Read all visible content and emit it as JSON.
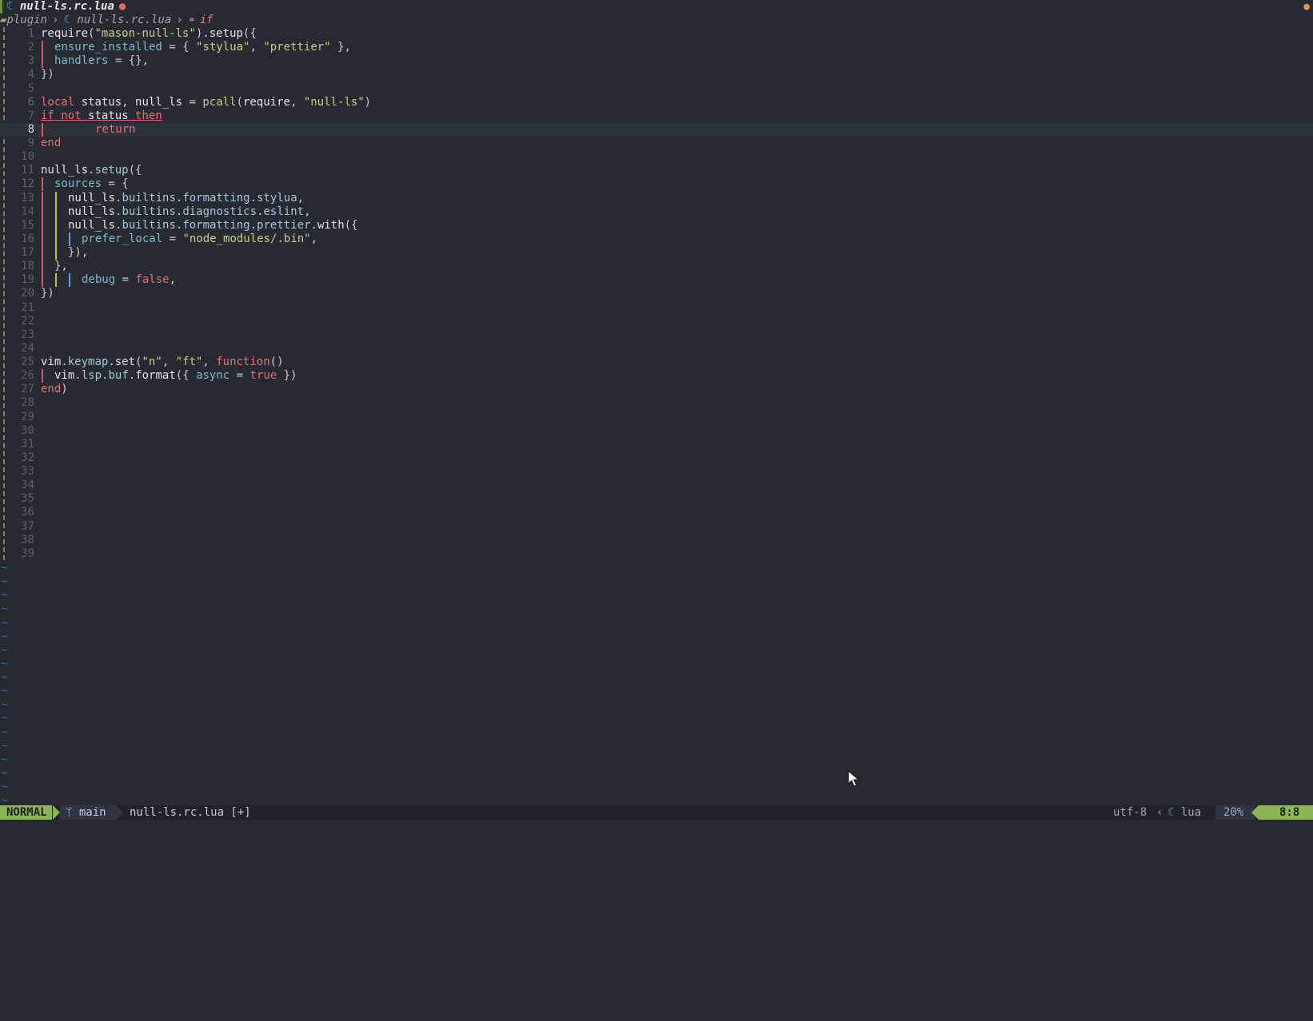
{
  "tabline": {
    "file_icon": "lua-moon-icon",
    "filename": "null-ls.rc.lua",
    "modified_indicator": "●",
    "right_indicator": "●"
  },
  "winbar": {
    "folder": "plugin",
    "separator": "›",
    "file": "null-ls.rc.lua",
    "scope_icon": "⚭",
    "scope": "if"
  },
  "editor": {
    "lines": [
      {
        "n": "1",
        "tokens": [
          [
            "fn",
            "require"
          ],
          [
            "punc",
            "("
          ],
          [
            "str",
            "\"mason-null-ls\""
          ],
          [
            "punc",
            ")."
          ],
          [
            "fn",
            "setup"
          ],
          [
            "punc",
            "({"
          ]
        ]
      },
      {
        "n": "2",
        "guides": [
          "red"
        ],
        "tokens": [
          [
            "var",
            "ensure_installed"
          ],
          [
            "punc",
            " = { "
          ],
          [
            "str",
            "\"stylua\""
          ],
          [
            "punc",
            ", "
          ],
          [
            "str",
            "\"prettier\""
          ],
          [
            "punc",
            " },"
          ]
        ]
      },
      {
        "n": "3",
        "guides": [
          "red"
        ],
        "tokens": [
          [
            "var",
            "handlers"
          ],
          [
            "punc",
            " = {},"
          ]
        ]
      },
      {
        "n": "4",
        "tokens": [
          [
            "punc",
            "})"
          ]
        ]
      },
      {
        "n": "5",
        "tokens": []
      },
      {
        "n": "6",
        "tokens": [
          [
            "kw",
            "local"
          ],
          [
            "punc",
            " "
          ],
          [
            "fn",
            "status"
          ],
          [
            "punc",
            ", "
          ],
          [
            "fn",
            "null_ls"
          ],
          [
            "punc",
            " = "
          ],
          [
            "str",
            "pcall"
          ],
          [
            "punc",
            "("
          ],
          [
            "fn",
            "require"
          ],
          [
            "punc",
            ", "
          ],
          [
            "str",
            "\"null-ls\""
          ],
          [
            "punc",
            ")"
          ]
        ]
      },
      {
        "n": "7",
        "underline": true,
        "tokens": [
          [
            "kw",
            "if"
          ],
          [
            "punc",
            " "
          ],
          [
            "kw",
            "not"
          ],
          [
            "punc",
            " "
          ],
          [
            "fn",
            "status"
          ],
          [
            "punc",
            " "
          ],
          [
            "kw",
            "then"
          ]
        ]
      },
      {
        "n": "8",
        "current": true,
        "guides": [
          "red",
          "pad",
          "pad",
          "pad"
        ],
        "tokens": [
          [
            "kw",
            "return"
          ]
        ]
      },
      {
        "n": "9",
        "tokens": [
          [
            "kw",
            "end"
          ]
        ]
      },
      {
        "n": "10",
        "tokens": []
      },
      {
        "n": "11",
        "tokens": [
          [
            "fn",
            "null_ls"
          ],
          [
            "punc",
            "."
          ],
          [
            "field",
            "setup"
          ],
          [
            "punc",
            "({"
          ]
        ]
      },
      {
        "n": "12",
        "guides": [
          "red"
        ],
        "tokens": [
          [
            "var",
            "sources"
          ],
          [
            "punc",
            " = {"
          ]
        ]
      },
      {
        "n": "13",
        "guides": [
          "red",
          "yel"
        ],
        "tokens": [
          [
            "fn",
            "null_ls"
          ],
          [
            "punc",
            "."
          ],
          [
            "field",
            "builtins"
          ],
          [
            "punc",
            "."
          ],
          [
            "field",
            "formatting"
          ],
          [
            "punc",
            "."
          ],
          [
            "field",
            "stylua"
          ],
          [
            "punc",
            ","
          ]
        ]
      },
      {
        "n": "14",
        "guides": [
          "red",
          "yel"
        ],
        "tokens": [
          [
            "fn",
            "null_ls"
          ],
          [
            "punc",
            "."
          ],
          [
            "field",
            "builtins"
          ],
          [
            "punc",
            "."
          ],
          [
            "field",
            "diagnostics"
          ],
          [
            "punc",
            "."
          ],
          [
            "field",
            "eslint"
          ],
          [
            "punc",
            ","
          ]
        ]
      },
      {
        "n": "15",
        "guides": [
          "red",
          "yel"
        ],
        "tokens": [
          [
            "fn",
            "null_ls"
          ],
          [
            "punc",
            "."
          ],
          [
            "field",
            "builtins"
          ],
          [
            "punc",
            "."
          ],
          [
            "field",
            "formatting"
          ],
          [
            "punc",
            "."
          ],
          [
            "field",
            "prettier"
          ],
          [
            "punc",
            "."
          ],
          [
            "fn",
            "with"
          ],
          [
            "punc",
            "({"
          ]
        ]
      },
      {
        "n": "16",
        "guides": [
          "red",
          "yel",
          "blue"
        ],
        "tokens": [
          [
            "var",
            "prefer_local"
          ],
          [
            "punc",
            " = "
          ],
          [
            "str",
            "\"node_modules/.bin\""
          ],
          [
            "punc",
            ","
          ]
        ]
      },
      {
        "n": "17",
        "guides": [
          "red",
          "yel"
        ],
        "tokens": [
          [
            "punc",
            "}),"
          ]
        ]
      },
      {
        "n": "18",
        "guides": [
          "red"
        ],
        "tokens": [
          [
            "punc",
            "},"
          ]
        ]
      },
      {
        "n": "19",
        "guides": [
          "red",
          "yel",
          "blue"
        ],
        "tokens": [
          [
            "var",
            "debug"
          ],
          [
            "punc",
            " = "
          ],
          [
            "bool",
            "false"
          ],
          [
            "punc",
            ","
          ]
        ]
      },
      {
        "n": "20",
        "tokens": [
          [
            "punc",
            "})"
          ]
        ]
      },
      {
        "n": "21",
        "tokens": []
      },
      {
        "n": "22",
        "tokens": []
      },
      {
        "n": "23",
        "tokens": []
      },
      {
        "n": "24",
        "tokens": []
      },
      {
        "n": "25",
        "tokens": [
          [
            "fn",
            "vim"
          ],
          [
            "punc",
            "."
          ],
          [
            "field",
            "keymap"
          ],
          [
            "punc",
            "."
          ],
          [
            "fn",
            "set"
          ],
          [
            "punc",
            "("
          ],
          [
            "str",
            "\"n\""
          ],
          [
            "punc",
            ", "
          ],
          [
            "str",
            "\"ft\""
          ],
          [
            "punc",
            ", "
          ],
          [
            "kw",
            "function"
          ],
          [
            "punc",
            "()"
          ]
        ]
      },
      {
        "n": "26",
        "guides": [
          "red"
        ],
        "tokens": [
          [
            "fn",
            "vim"
          ],
          [
            "punc",
            "."
          ],
          [
            "field",
            "lsp"
          ],
          [
            "punc",
            "."
          ],
          [
            "field",
            "buf"
          ],
          [
            "punc",
            "."
          ],
          [
            "fn",
            "format"
          ],
          [
            "punc",
            "({ "
          ],
          [
            "var",
            "async"
          ],
          [
            "punc",
            " = "
          ],
          [
            "bool",
            "true"
          ],
          [
            "punc",
            " })"
          ]
        ]
      },
      {
        "n": "27",
        "tokens": [
          [
            "kw",
            "end"
          ],
          [
            "punc",
            ")"
          ]
        ]
      },
      {
        "n": "28",
        "tokens": []
      },
      {
        "n": "29",
        "tokens": []
      },
      {
        "n": "30",
        "tokens": []
      },
      {
        "n": "31",
        "tokens": []
      },
      {
        "n": "32",
        "tokens": []
      },
      {
        "n": "33",
        "tokens": []
      },
      {
        "n": "34",
        "tokens": []
      },
      {
        "n": "35",
        "tokens": []
      },
      {
        "n": "36",
        "tokens": []
      },
      {
        "n": "37",
        "tokens": []
      },
      {
        "n": "38",
        "tokens": []
      },
      {
        "n": "39",
        "tokens": []
      }
    ],
    "filler": "~",
    "filler_count": 18
  },
  "statusline": {
    "mode": "NORMAL",
    "branch_icon": "git-branch-icon",
    "branch": "main",
    "file": "null-ls.rc.lua [+]",
    "encoding": "utf-8",
    "ft_separator": "‹",
    "filetype_icon": "lua-moon-icon",
    "filetype": "lua",
    "percent": "20%",
    "position": "8:8"
  },
  "colors": {
    "background": "#262b33",
    "mode_green": "#8bb552",
    "keyword": "#ef6b73",
    "string": "#c3d08a"
  }
}
